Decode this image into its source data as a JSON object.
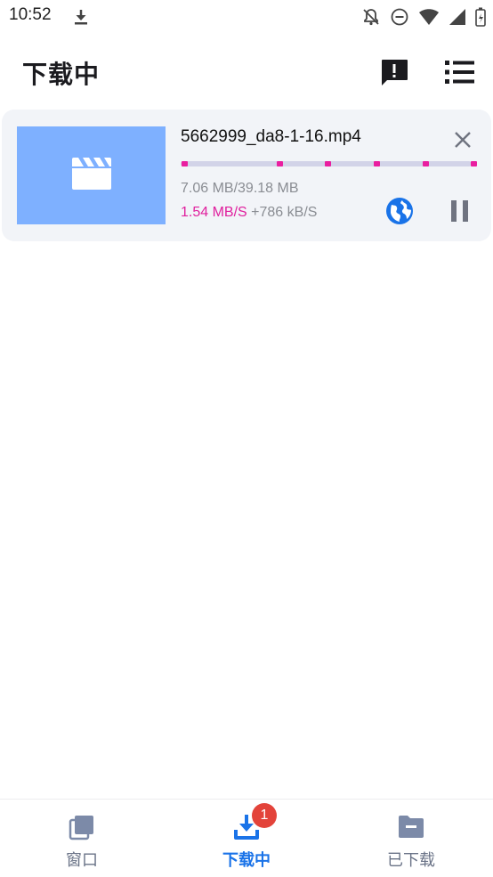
{
  "status_bar": {
    "time": "10:52",
    "icons": [
      "download-icon",
      "notifications-off-icon",
      "do-not-disturb-icon",
      "wifi-icon",
      "cellular-signal-icon",
      "battery-icon"
    ]
  },
  "app_bar": {
    "title": "下载中",
    "actions": [
      "feedback-icon",
      "list-icon"
    ]
  },
  "downloads": [
    {
      "file_name": "5662999_da8-1-16.mp4",
      "size_progress": "7.06 MB/39.18 MB",
      "speed": "1.54 MB/S",
      "extra_speed": "+786 kB/S",
      "progress_fraction": 0.18,
      "thumbnail_icon": "movie-clapper-icon",
      "actions": [
        "close-icon",
        "globe-icon",
        "pause-icon"
      ]
    }
  ],
  "bottom_nav": {
    "items": [
      {
        "label": "窗口",
        "icon": "windows-stack-icon",
        "active": false
      },
      {
        "label": "下载中",
        "icon": "download-tray-icon",
        "active": true,
        "badge": "1"
      },
      {
        "label": "已下载",
        "icon": "folder-icon",
        "active": false
      }
    ]
  },
  "colors": {
    "accent": "#1a73e8",
    "progress": "#e91ea0",
    "progress_track": "#d2d3e8",
    "thumbnail": "#7eb0ff",
    "card_background": "#f2f4f8",
    "badge": "#e3433a",
    "inactive_nav": "#7c8aa8"
  }
}
